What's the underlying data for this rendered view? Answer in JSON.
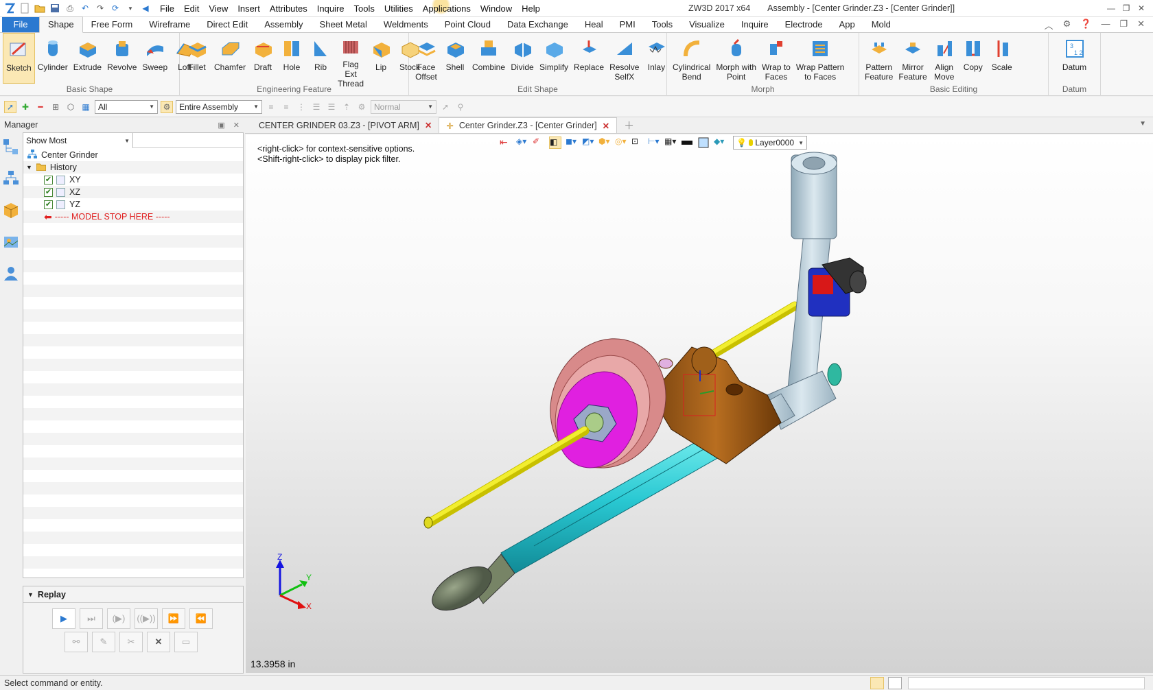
{
  "titlebar": {
    "menu": [
      "File",
      "Edit",
      "View",
      "Insert",
      "Attributes",
      "Inquire",
      "Tools",
      "Utilities",
      "Applications",
      "Window",
      "Help"
    ],
    "app": "ZW3D 2017  x64",
    "doc_title": "Assembly - [Center Grinder.Z3 - [Center Grinder]]"
  },
  "ribbon_tabs": [
    "File",
    "Shape",
    "Free Form",
    "Wireframe",
    "Direct Edit",
    "Assembly",
    "Sheet Metal",
    "Weldments",
    "Point Cloud",
    "Data Exchange",
    "Heal",
    "PMI",
    "Tools",
    "Visualize",
    "Inquire",
    "Electrode",
    "App",
    "Mold"
  ],
  "ribbon_groups": [
    {
      "label": "Basic Shape",
      "buttons": [
        "Sketch",
        "Cylinder",
        "Extrude",
        "Revolve",
        "Sweep",
        "Loft"
      ]
    },
    {
      "label": "Engineering Feature",
      "buttons": [
        "Fillet",
        "Chamfer",
        "Draft",
        "Hole",
        "Rib",
        "Flag Ext\nThread",
        "Lip",
        "Stock"
      ]
    },
    {
      "label": "Edit Shape",
      "buttons": [
        "Face\nOffset",
        "Shell",
        "Combine",
        "Divide",
        "Simplify",
        "Replace",
        "Resolve\nSelfX",
        "Inlay"
      ]
    },
    {
      "label": "Morph",
      "buttons": [
        "Cylindrical\nBend",
        "Morph with\nPoint",
        "Wrap to\nFaces",
        "Wrap Pattern\nto Faces"
      ]
    },
    {
      "label": "Basic Editing",
      "buttons": [
        "Pattern\nFeature",
        "Mirror\nFeature",
        "Align\nMove",
        "Copy",
        "Scale"
      ]
    },
    {
      "label": "Datum",
      "buttons": [
        "Datum"
      ]
    }
  ],
  "cmdbar": {
    "filter": "All",
    "scope": "Entire Assembly",
    "mode": "Normal"
  },
  "manager": {
    "title": "Manager",
    "show": "Show Most",
    "tree": {
      "root": "Center Grinder",
      "history": "History",
      "planes": [
        "XY",
        "XZ",
        "YZ"
      ],
      "stop": "----- MODEL STOP HERE -----"
    },
    "replay": "Replay"
  },
  "doc_tabs": [
    "CENTER GRINDER 03.Z3 - [PIVOT ARM]",
    "Center Grinder.Z3 - [Center Grinder]"
  ],
  "viewport": {
    "layer": "Layer0000",
    "hint1": "<right-click> for context-sensitive options.",
    "hint2": "<Shift-right-click> to display pick filter.",
    "measure": "13.3958 in",
    "axes": {
      "x": "X",
      "y": "Y",
      "z": "Z"
    }
  },
  "status": "Select command or entity."
}
